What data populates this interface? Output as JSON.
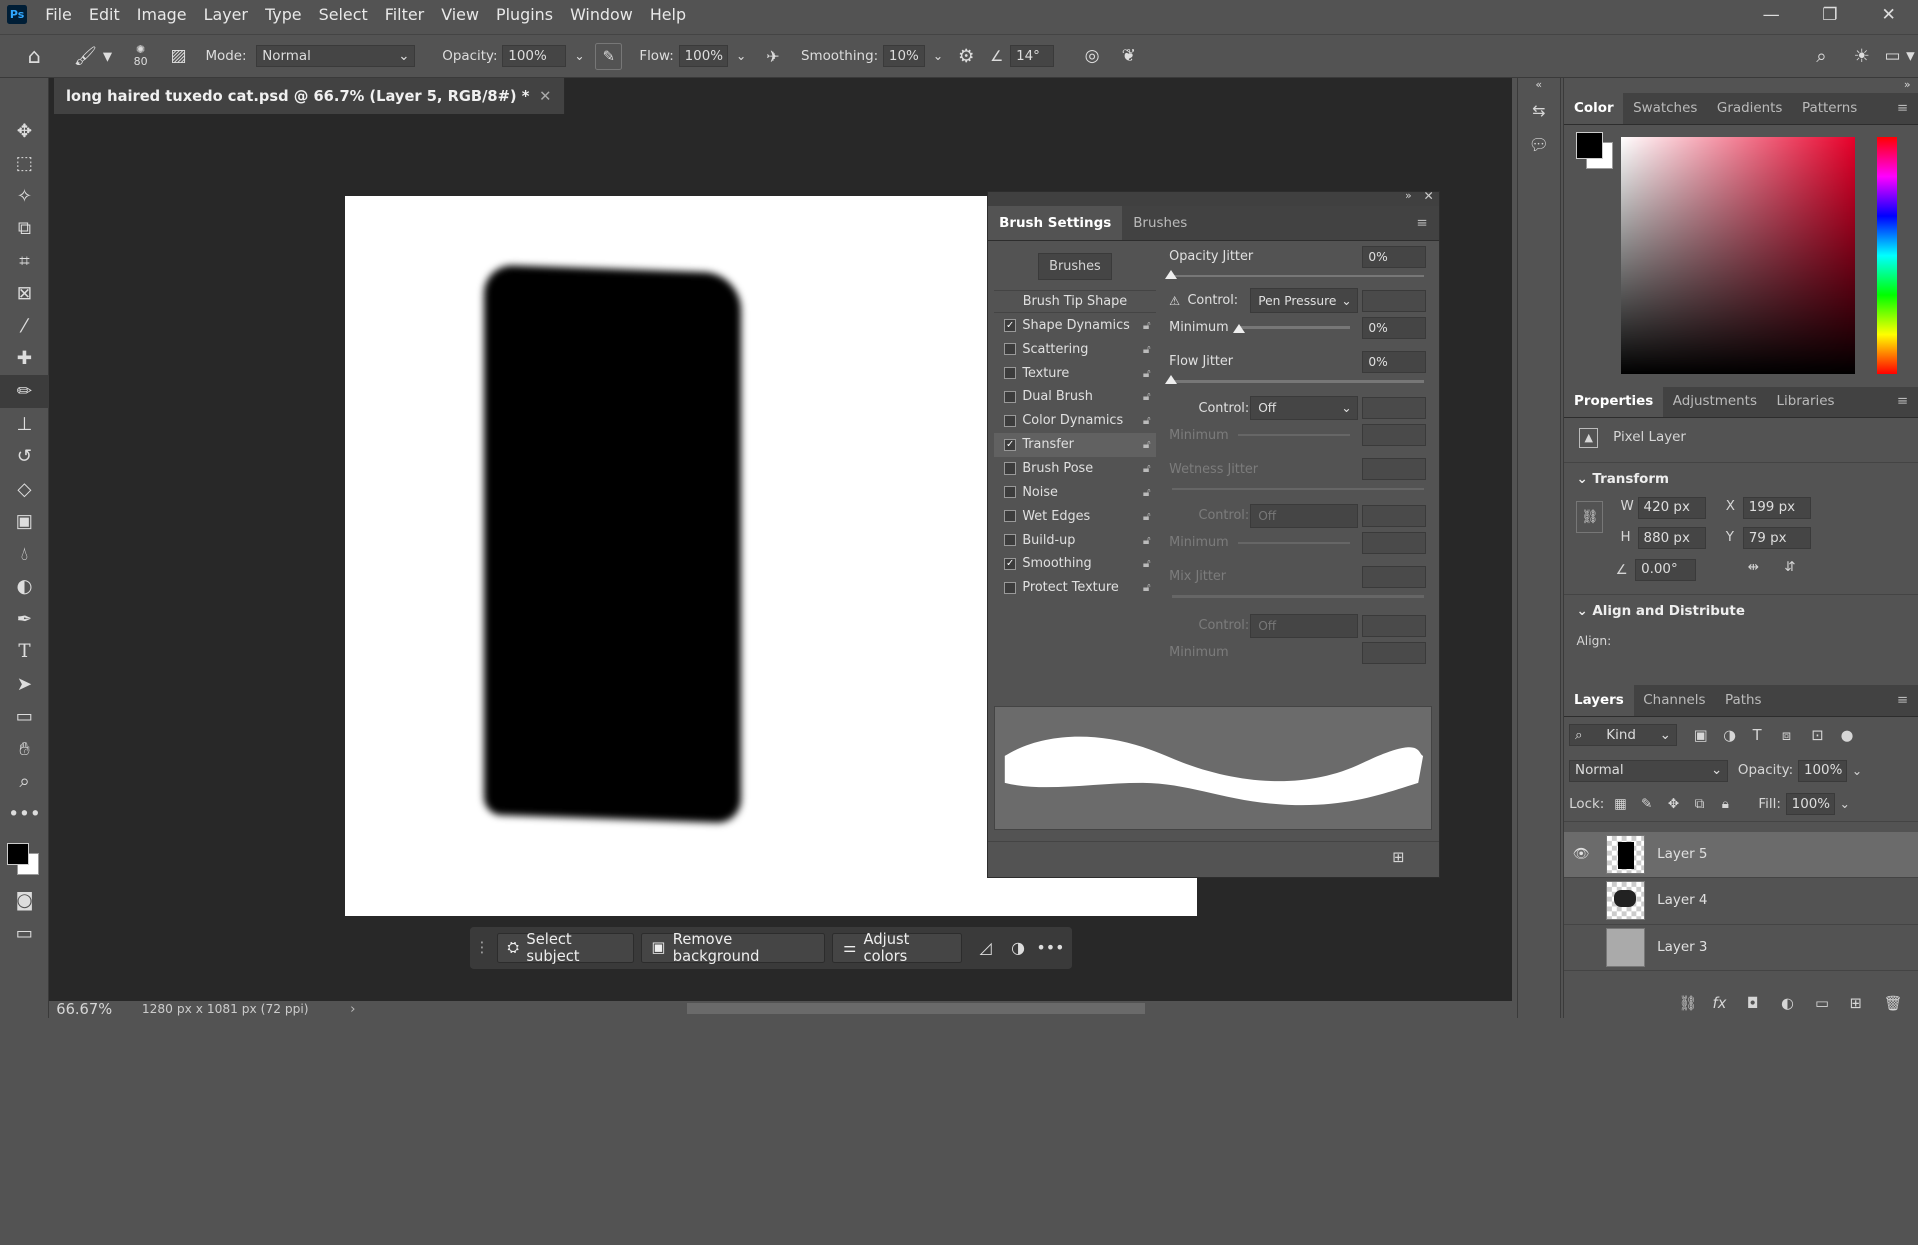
{
  "app": {
    "logo": "Ps",
    "menu": [
      "File",
      "Edit",
      "Image",
      "Layer",
      "Type",
      "Select",
      "Filter",
      "View",
      "Plugins",
      "Window",
      "Help"
    ]
  },
  "options": {
    "brush_size": "80",
    "mode_label": "Mode:",
    "mode_value": "Normal",
    "opacity_label": "Opacity:",
    "opacity_value": "100%",
    "flow_label": "Flow:",
    "flow_value": "100%",
    "smoothing_label": "Smoothing:",
    "smoothing_value": "10%",
    "angle_value": "14°"
  },
  "document": {
    "tab_title": "long haired tuxedo cat.psd @ 66.7% (Layer 5, RGB/8#) *"
  },
  "context_bar": {
    "select_subject": "Select subject",
    "remove_background": "Remove background",
    "adjust_colors": "Adjust colors"
  },
  "status": {
    "zoom": "66.67%",
    "doc_info": "1280 px x 1081 px (72 ppi)"
  },
  "brush_settings": {
    "tabs": [
      "Brush Settings",
      "Brushes"
    ],
    "brushes_button": "Brushes",
    "tip_shape": "Brush Tip Shape",
    "items": [
      {
        "label": "Shape Dynamics",
        "checked": "✓"
      },
      {
        "label": "Scattering",
        "checked": ""
      },
      {
        "label": "Texture",
        "checked": ""
      },
      {
        "label": "Dual Brush",
        "checked": ""
      },
      {
        "label": "Color Dynamics",
        "checked": ""
      },
      {
        "label": "Transfer",
        "checked": "✓"
      },
      {
        "label": "Brush Pose",
        "checked": ""
      },
      {
        "label": "Noise",
        "checked": ""
      },
      {
        "label": "Wet Edges",
        "checked": ""
      },
      {
        "label": "Build-up",
        "checked": ""
      },
      {
        "label": "Smoothing",
        "checked": "✓"
      },
      {
        "label": "Protect Texture",
        "checked": ""
      }
    ],
    "opacity_jitter": "Opacity Jitter",
    "opacity_jitter_value": "0%",
    "control_label": "Control:",
    "control_value": "Pen Pressure",
    "minimum_label": "Minimum",
    "minimum_value": "0%",
    "flow_jitter": "Flow Jitter",
    "flow_jitter_value": "0%",
    "control2_value": "Off",
    "wetness_jitter": "Wetness Jitter",
    "control3_value": "Off",
    "mix_jitter": "Mix Jitter",
    "control4_value": "Off"
  },
  "color_panel": {
    "tabs": [
      "Color",
      "Swatches",
      "Gradients",
      "Patterns"
    ]
  },
  "properties": {
    "tabs": [
      "Properties",
      "Adjustments",
      "Libraries"
    ],
    "layer_kind": "Pixel Layer",
    "transform": "Transform",
    "w_label": "W",
    "w": "420 px",
    "x_label": "X",
    "x": "199 px",
    "h_label": "H",
    "h": "880 px",
    "y_label": "Y",
    "y": "79 px",
    "angle": "0.00°",
    "align": "Align and Distribute",
    "align_label": "Align:"
  },
  "layers": {
    "tabs": [
      "Layers",
      "Channels",
      "Paths"
    ],
    "kind": "Kind",
    "blend": "Normal",
    "opacity_label": "Opacity:",
    "opacity": "100%",
    "lock_label": "Lock:",
    "fill_label": "Fill:",
    "fill": "100%",
    "items": [
      "Layer 5",
      "Layer 4",
      "Layer 3"
    ]
  },
  "colors": {
    "accent": "#31a8ff",
    "ui_bg": "#535353",
    "canvas_bg": "#282828"
  }
}
